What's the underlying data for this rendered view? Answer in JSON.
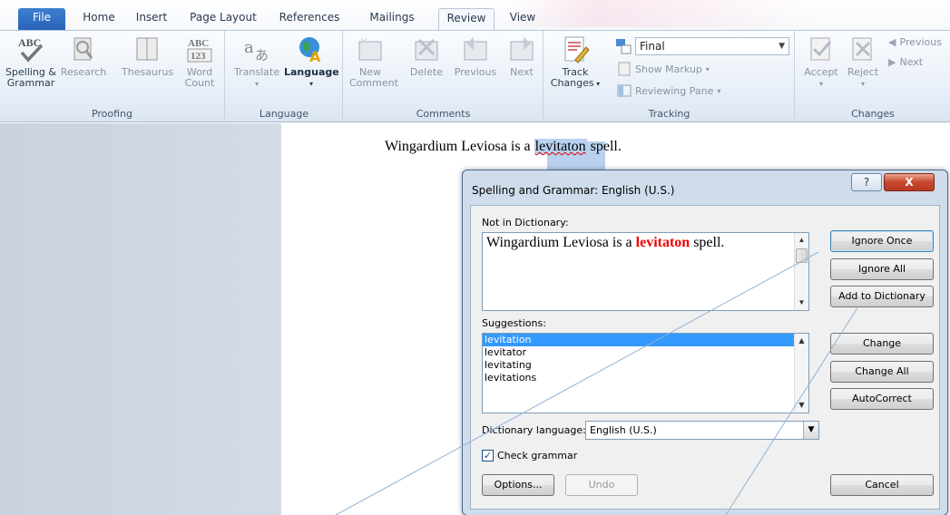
{
  "ribbon": {
    "tabs": [
      {
        "label": "File"
      },
      {
        "label": "Home"
      },
      {
        "label": "Insert"
      },
      {
        "label": "Page Layout"
      },
      {
        "label": "References"
      },
      {
        "label": "Mailings"
      },
      {
        "label": "Review"
      },
      {
        "label": "View"
      }
    ],
    "groups": {
      "proofing": {
        "label": "Proofing",
        "spelling_line1": "Spelling &",
        "spelling_line2": "Grammar",
        "research": "Research",
        "thesaurus": "Thesaurus",
        "wordcount_line1": "Word",
        "wordcount_line2": "Count",
        "abc_icon_text": "ABC",
        "abc123_icon_top": "ABC",
        "abc123_icon_bottom": "123"
      },
      "language": {
        "label": "Language",
        "translate": "Translate",
        "language": "Language"
      },
      "comments": {
        "label": "Comments",
        "new_line1": "New",
        "new_line2": "Comment",
        "delete": "Delete",
        "previous": "Previous",
        "next": "Next"
      },
      "tracking": {
        "label": "Tracking",
        "track_line1": "Track",
        "track_line2": "Changes",
        "display_for_review": "Final",
        "show_markup": "Show Markup",
        "reviewing_pane": "Reviewing Pane"
      },
      "changes": {
        "label": "Changes",
        "accept": "Accept",
        "reject": "Reject",
        "previous": "Previous",
        "next": "Next"
      }
    }
  },
  "document": {
    "before": "Wingardium Leviosa is a ",
    "misspelled": "levitaton",
    "after": " spell."
  },
  "dialog": {
    "title": "Spelling and Grammar: English (U.S.)",
    "help_label": "?",
    "close_label": "X",
    "not_in_dictionary_label": "Not in Dictionary:",
    "sentence_before": "Wingardium Leviosa is a ",
    "sentence_error": "levitaton",
    "sentence_after": " spell.",
    "suggestions_label": "Suggestions:",
    "suggestions": [
      "levitation",
      "levitator",
      "levitating",
      "levitations"
    ],
    "dictionary_language_label": "Dictionary language:",
    "dictionary_language_value": "English (U.S.)",
    "check_grammar_label": "Check grammar",
    "check_grammar_checked": true,
    "buttons": {
      "ignore_once": "Ignore Once",
      "ignore_all": "Ignore All",
      "add_to_dictionary": "Add to Dictionary",
      "change": "Change",
      "change_all": "Change All",
      "autocorrect": "AutoCorrect",
      "options": "Options...",
      "undo": "Undo",
      "cancel": "Cancel"
    }
  },
  "colors": {
    "file_tab": "#2a62b8",
    "error_text": "#e00000",
    "selection": "#3399ff",
    "close_button": "#c8472d"
  }
}
